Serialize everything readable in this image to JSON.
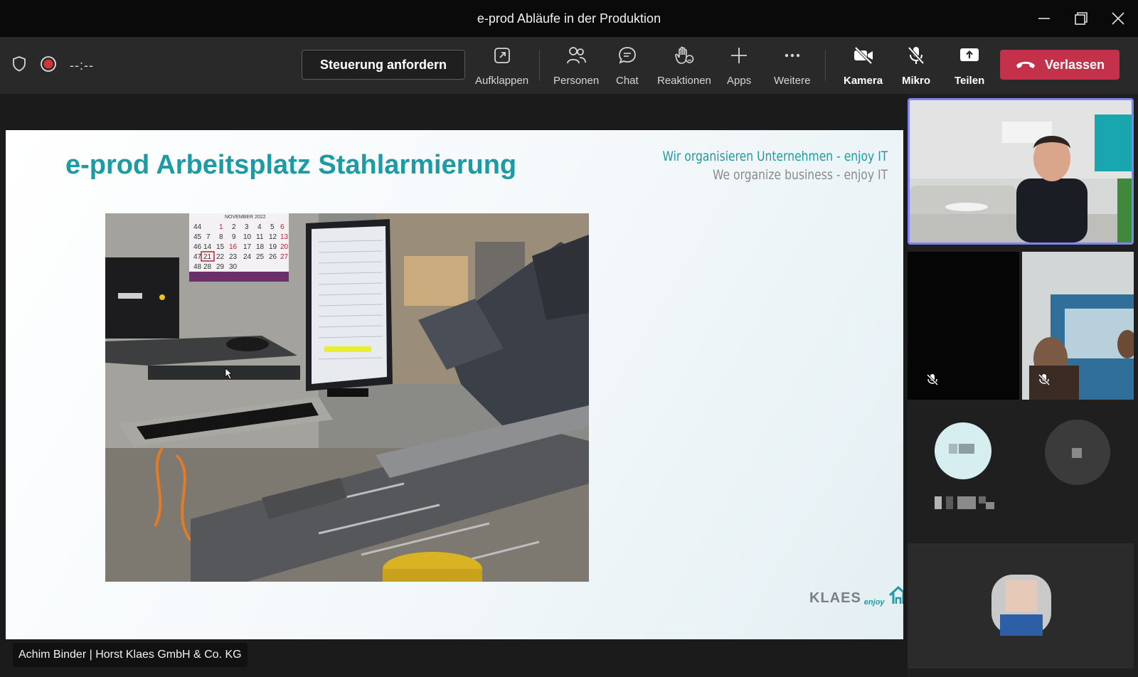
{
  "window": {
    "title": "e-prod Abläufe in der Produktion"
  },
  "toolbar": {
    "timer": "--:--",
    "request_control_label": "Steuerung anfordern",
    "items": {
      "aufklappen": "Aufklappen",
      "personen": "Personen",
      "chat": "Chat",
      "reaktionen": "Reaktionen",
      "apps": "Apps",
      "weitere": "Weitere",
      "kamera": "Kamera",
      "mikro": "Mikro",
      "teilen": "Teilen"
    },
    "leave_label": "Verlassen",
    "leave_color": "#c4314b"
  },
  "slide": {
    "title": "e-prod Arbeitsplatz Stahlarmierung",
    "tagline_de": "Wir organisieren Unternehmen - enjoy IT",
    "tagline_en": "We organize business - enjoy IT",
    "logo_brand": "KLAES",
    "logo_sub": "enjoy",
    "accent_color": "#1d9aa4",
    "calendar_month": "NOVEMBER 2022"
  },
  "presenter": {
    "name_tag": "Achim Binder | Horst Klaes GmbH & Co. KG"
  },
  "panel": {
    "active_speaker_border": "#7f85f5"
  }
}
